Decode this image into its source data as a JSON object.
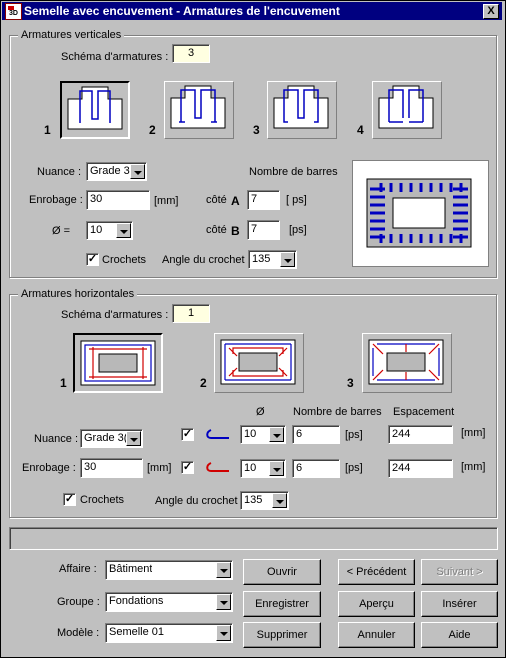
{
  "title": "Semelle avec encuvement - Armatures de l'encuvement",
  "close_symbol": "X",
  "vert": {
    "group_label": "Armatures verticales",
    "schema_label": "Schéma d'armatures :",
    "schema_value": "3",
    "schema_numbers": [
      "1",
      "2",
      "3",
      "4"
    ],
    "nuance_label": "Nuance :",
    "nuance_value": "Grade 3(",
    "enrobage_label": "Enrobage :",
    "enrobage_value": "30",
    "enrobage_unit": "[mm]",
    "diam_label": "Ø =",
    "diam_value": "10",
    "nb_barres_label": "Nombre de barres",
    "cote_a_label": "côté",
    "cote_a_letter": "A",
    "cote_a_value": "7",
    "cote_a_unit": "[ ps]",
    "cote_b_label": "côté",
    "cote_b_letter": "B",
    "cote_b_value": "7",
    "cote_b_unit": "[ps]",
    "crochets_label": "Crochets",
    "crochets_checked": "✓",
    "angle_label": "Angle du crochet",
    "angle_value": "135"
  },
  "horiz": {
    "group_label": "Armatures horizontales",
    "schema_label": "Schéma d'armatures :",
    "schema_value": "1",
    "schema_numbers": [
      "1",
      "2",
      "3"
    ],
    "diam_header": "Ø",
    "nb_barres_header": "Nombre de barres",
    "espacement_header": "Espacement",
    "nuance_label": "Nuance :",
    "nuance_value": "Grade 3(",
    "enrobage_label": "Enrobage :",
    "enrobage_value": "30",
    "enrobage_unit": "[mm]",
    "row1": {
      "checked": "✓",
      "diam": "10",
      "nb": "6",
      "nb_unit": "[ps]",
      "esp": "244",
      "esp_unit": "[mm]"
    },
    "row2": {
      "checked": "✓",
      "diam": "10",
      "nb": "6",
      "nb_unit": "[ps]",
      "esp": "244",
      "esp_unit": "[mm]"
    },
    "crochets_label": "Crochets",
    "crochets_checked": "✓",
    "angle_label": "Angle du crochet",
    "angle_value": "135"
  },
  "status_text": "",
  "footer": {
    "affaire_label": "Affaire :",
    "affaire_value": "Bâtiment",
    "groupe_label": "Groupe :",
    "groupe_value": "Fondations",
    "modele_label": "Modèle :",
    "modele_value": "Semelle 01",
    "ouvrir": "Ouvrir",
    "enregistrer": "Enregistrer",
    "supprimer": "Supprimer",
    "precedent": "< Précédent",
    "suivant": "Suivant >",
    "apercu": "Aperçu",
    "annuler": "Annuler",
    "inserer": "Insérer",
    "aide": "Aide"
  },
  "colors": {
    "title_bg": "#000080",
    "rebar_blue": "#0000c0",
    "rebar_red": "#d00000",
    "field_highlight": "#ffffe1"
  }
}
